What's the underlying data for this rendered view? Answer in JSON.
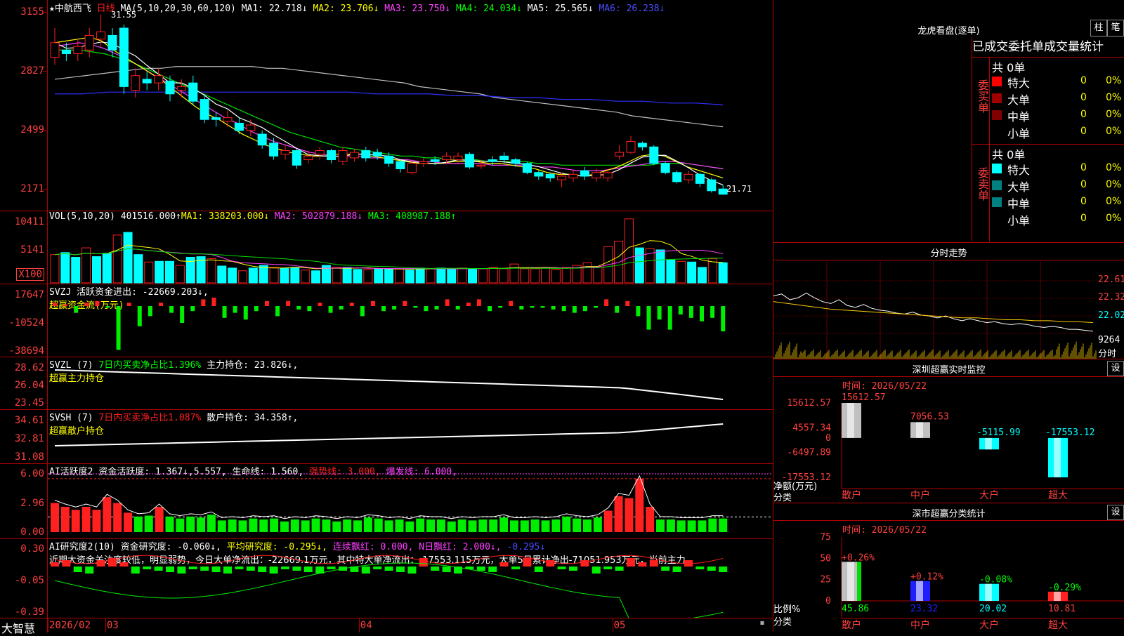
{
  "stock": {
    "name": "中航西飞",
    "period": "日线",
    "ma_header": "MA(5,10,20,30,60,120)",
    "ma": [
      {
        "label": "MA1: 22.718↓",
        "color": "#ffffff"
      },
      {
        "label": "MA2: 23.706↓",
        "color": "#ffff00"
      },
      {
        "label": "MA3: 23.750↓",
        "color": "#ff40ff"
      },
      {
        "label": "MA4: 24.034↓",
        "color": "#00ff00"
      },
      {
        "label": "MA5: 25.565↓",
        "color": "#ffffff"
      },
      {
        "label": "MA6: 26.238↓",
        "color": "#4a4aff"
      }
    ],
    "y_ticks": [
      "3155",
      "2827",
      "2499",
      "2171"
    ],
    "high_label": "31.55",
    "low_label": "21.71"
  },
  "candles": [
    {
      "o": 29.2,
      "c": 30.0,
      "h": 30.8,
      "l": 28.8
    },
    {
      "o": 29.6,
      "c": 29.4,
      "h": 30.0,
      "l": 29.0
    },
    {
      "o": 29.4,
      "c": 29.8,
      "h": 30.2,
      "l": 29.0
    },
    {
      "o": 29.6,
      "c": 30.4,
      "h": 30.8,
      "l": 29.2
    },
    {
      "o": 30.2,
      "c": 30.6,
      "h": 31.55,
      "l": 29.8
    },
    {
      "o": 30.4,
      "c": 29.6,
      "h": 30.8,
      "l": 29.2
    },
    {
      "o": 30.8,
      "c": 27.6,
      "h": 31.0,
      "l": 27.2
    },
    {
      "o": 27.4,
      "c": 28.2,
      "h": 28.6,
      "l": 27.0
    },
    {
      "o": 28.0,
      "c": 27.8,
      "h": 28.4,
      "l": 27.4
    },
    {
      "o": 27.8,
      "c": 28.2,
      "h": 28.6,
      "l": 27.4
    },
    {
      "o": 27.9,
      "c": 27.2,
      "h": 28.2,
      "l": 26.8
    },
    {
      "o": 27.4,
      "c": 27.6,
      "h": 28.0,
      "l": 27.0
    },
    {
      "o": 27.8,
      "c": 26.8,
      "h": 28.2,
      "l": 26.6
    },
    {
      "o": 26.9,
      "c": 25.8,
      "h": 27.2,
      "l": 25.6
    },
    {
      "o": 25.9,
      "c": 25.8,
      "h": 26.2,
      "l": 25.4
    },
    {
      "o": 25.7,
      "c": 25.9,
      "h": 26.3,
      "l": 25.4
    },
    {
      "o": 25.6,
      "c": 25.2,
      "h": 25.9,
      "l": 25.0
    },
    {
      "o": 25.2,
      "c": 25.5,
      "h": 25.8,
      "l": 24.9
    },
    {
      "o": 25.0,
      "c": 24.4,
      "h": 25.2,
      "l": 24.2
    },
    {
      "o": 24.5,
      "c": 23.8,
      "h": 24.8,
      "l": 23.6
    },
    {
      "o": 23.9,
      "c": 24.1,
      "h": 24.4,
      "l": 23.6
    },
    {
      "o": 24.1,
      "c": 23.3,
      "h": 24.2,
      "l": 23.1
    },
    {
      "o": 23.6,
      "c": 23.8,
      "h": 24.1,
      "l": 23.4
    },
    {
      "o": 23.9,
      "c": 24.1,
      "h": 24.3,
      "l": 23.6
    },
    {
      "o": 24.1,
      "c": 23.6,
      "h": 24.2,
      "l": 23.4
    },
    {
      "o": 23.5,
      "c": 24.1,
      "h": 24.3,
      "l": 23.3
    },
    {
      "o": 23.7,
      "c": 24.0,
      "h": 24.2,
      "l": 23.5
    },
    {
      "o": 24.1,
      "c": 23.7,
      "h": 24.3,
      "l": 23.5
    },
    {
      "o": 24.0,
      "c": 23.8,
      "h": 24.2,
      "l": 23.6
    },
    {
      "o": 23.8,
      "c": 23.4,
      "h": 24.0,
      "l": 23.2
    },
    {
      "o": 23.5,
      "c": 23.1,
      "h": 23.6,
      "l": 22.9
    },
    {
      "o": 22.9,
      "c": 23.4,
      "h": 23.6,
      "l": 22.8
    },
    {
      "o": 23.4,
      "c": 23.5,
      "h": 23.7,
      "l": 23.2
    },
    {
      "o": 23.6,
      "c": 23.5,
      "h": 23.8,
      "l": 23.3
    },
    {
      "o": 23.6,
      "c": 23.8,
      "h": 24.0,
      "l": 23.4
    },
    {
      "o": 23.6,
      "c": 23.8,
      "h": 24.0,
      "l": 23.4
    },
    {
      "o": 23.9,
      "c": 23.2,
      "h": 24.0,
      "l": 23.1
    },
    {
      "o": 23.3,
      "c": 23.3,
      "h": 23.6,
      "l": 23.1
    },
    {
      "o": 23.6,
      "c": 23.5,
      "h": 23.8,
      "l": 23.3
    },
    {
      "o": 23.8,
      "c": 23.6,
      "h": 24.0,
      "l": 23.4
    },
    {
      "o": 23.6,
      "c": 23.4,
      "h": 23.7,
      "l": 23.2
    },
    {
      "o": 23.4,
      "c": 22.9,
      "h": 23.5,
      "l": 22.8
    },
    {
      "o": 22.9,
      "c": 22.7,
      "h": 23.0,
      "l": 22.5
    },
    {
      "o": 22.8,
      "c": 22.6,
      "h": 22.9,
      "l": 22.4
    },
    {
      "o": 22.5,
      "c": 22.7,
      "h": 22.9,
      "l": 22.1
    },
    {
      "o": 22.6,
      "c": 22.8,
      "h": 23.0,
      "l": 22.4
    },
    {
      "o": 23.0,
      "c": 22.7,
      "h": 23.2,
      "l": 22.5
    },
    {
      "o": 22.6,
      "c": 22.9,
      "h": 23.1,
      "l": 22.4
    },
    {
      "o": 22.6,
      "c": 22.9,
      "h": 23.1,
      "l": 22.4
    },
    {
      "o": 23.8,
      "c": 24.0,
      "h": 24.4,
      "l": 23.6
    },
    {
      "o": 24.0,
      "c": 24.6,
      "h": 24.9,
      "l": 23.9
    },
    {
      "o": 24.5,
      "c": 24.3,
      "h": 24.6,
      "l": 24.1
    },
    {
      "o": 24.3,
      "c": 23.4,
      "h": 24.4,
      "l": 23.3
    },
    {
      "o": 23.4,
      "c": 22.9,
      "h": 23.5,
      "l": 22.8
    },
    {
      "o": 22.9,
      "c": 22.4,
      "h": 23.0,
      "l": 22.3
    },
    {
      "o": 22.5,
      "c": 22.8,
      "h": 23.0,
      "l": 22.3
    },
    {
      "o": 22.8,
      "c": 22.3,
      "h": 22.9,
      "l": 22.1
    },
    {
      "o": 22.5,
      "c": 21.9,
      "h": 22.6,
      "l": 21.8
    },
    {
      "o": 22.0,
      "c": 21.71,
      "h": 22.2,
      "l": 21.71
    }
  ],
  "ma_lines": {
    "yellow": [
      30.0,
      30.1,
      30.2,
      30.3,
      30.1,
      29.6,
      29.2,
      28.8,
      28.4,
      28.0,
      27.5,
      27.0,
      26.5,
      26.1,
      25.8,
      25.4,
      25.0,
      24.7,
      24.4,
      24.2,
      24.0,
      23.9,
      23.8,
      23.8,
      23.9,
      23.9,
      23.9,
      23.8,
      23.7,
      23.6,
      23.5,
      23.4,
      23.4,
      23.4,
      23.5,
      23.5,
      23.5,
      23.4,
      23.4,
      23.3,
      23.2,
      23.1,
      22.9,
      22.8,
      22.8,
      22.7,
      22.8,
      23.0,
      23.2,
      23.5,
      23.8,
      23.9,
      23.8,
      23.5,
      23.2,
      23.0,
      22.8,
      22.6
    ],
    "magenta": [
      29.8,
      29.9,
      30.0,
      29.9,
      29.7,
      29.4,
      29.1,
      28.7,
      28.3,
      27.9,
      27.5,
      27.1,
      26.7,
      26.3,
      25.9,
      25.6,
      25.2,
      24.9,
      24.6,
      24.4,
      24.2,
      24.0,
      23.9,
      23.8,
      23.8,
      23.8,
      23.7,
      23.7,
      23.6,
      23.6,
      23.5,
      23.5,
      23.4,
      23.4,
      23.4,
      23.4,
      23.3,
      23.3,
      23.3,
      23.3,
      23.2,
      23.2,
      23.1,
      23.0,
      23.0,
      23.0,
      23.1,
      23.2,
      23.3,
      23.4,
      23.5,
      23.5,
      23.4,
      23.3,
      23.2,
      23.1
    ],
    "green": [
      29.6,
      29.6,
      29.6,
      29.5,
      29.4,
      29.2,
      29.0,
      28.7,
      28.4,
      28.1,
      27.8,
      27.5,
      27.2,
      26.9,
      26.6,
      26.3,
      26.0,
      25.7,
      25.4,
      25.1,
      24.9,
      24.7,
      24.5,
      24.3,
      24.2,
      24.1,
      24.0,
      23.9,
      23.8,
      23.8,
      23.7,
      23.7,
      23.6,
      23.6,
      23.6,
      23.5,
      23.5,
      23.5,
      23.5,
      23.4,
      23.4,
      23.3,
      23.3,
      23.3,
      23.3,
      23.3,
      23.3,
      23.3,
      23.3,
      23.4,
      23.4,
      23.4,
      23.3,
      23.2,
      23.1
    ],
    "gray": [
      28.0,
      28.1,
      28.2,
      28.3,
      28.4,
      28.5,
      28.6,
      28.6,
      28.7,
      28.7,
      28.7,
      28.7,
      28.7,
      28.7,
      28.6,
      28.6,
      28.5,
      28.4,
      28.3,
      28.2,
      28.1,
      28.0,
      27.9,
      27.8,
      27.6,
      27.5,
      27.4,
      27.3,
      27.2,
      27.0,
      26.9,
      26.8,
      26.7,
      26.6,
      26.5,
      26.4,
      26.3,
      26.2,
      26.0,
      25.9,
      25.8,
      25.7,
      25.6,
      25.5,
      25.4
    ],
    "blue": [
      27.2,
      27.2,
      27.3,
      27.3,
      27.3,
      27.3,
      27.3,
      27.3,
      27.3,
      27.3,
      27.3,
      27.3,
      27.2,
      27.2,
      27.2,
      27.1,
      27.1,
      27.0,
      27.0,
      26.9,
      26.9,
      26.8,
      26.8,
      26.7,
      26.7,
      26.6
    ]
  },
  "vol": {
    "label": "VOL(5,10,20)",
    "value": "401516.000↑",
    "ma1": "MA1: 338203.000↓",
    "ma2": "MA2: 502879.188↓",
    "ma3": "MA3: 408987.188↑",
    "y_ticks": [
      "10411",
      "5141"
    ],
    "unit": "X100",
    "bars": [
      4.2,
      4.5,
      3.8,
      5.2,
      3.9,
      4.4,
      7.1,
      7.5,
      4.2,
      3.1,
      3.2,
      3.2,
      2.6,
      3.8,
      3.9,
      3.6,
      2.5,
      2.2,
      1.8,
      2.2,
      2.6,
      2.3,
      2.2,
      2.3,
      1.9,
      1.8,
      2.6,
      2.3,
      2.3,
      2.0,
      2.0,
      2.1,
      2.1,
      2.1,
      1.9,
      2.2,
      2.1,
      2.2,
      2.1,
      2.2,
      2.1,
      2.1,
      2.3,
      2.1,
      2.8,
      2.1,
      2.1,
      2.3,
      2.0,
      2.3,
      2.6,
      3.0,
      2.3,
      5.4,
      6.2,
      9.5,
      5.2,
      5.1,
      4.9,
      3.4,
      3.2,
      3.1,
      2.3,
      3.6,
      3.0
    ]
  },
  "svzj": {
    "label": "SVZJ",
    "value": "活跃资金进出: -22669.203↓,",
    "sub": "超赢资金流(万元)",
    "y_ticks": [
      "17647",
      "-10524",
      "-38694"
    ],
    "bars": [
      0.2,
      0.1,
      -0.4,
      0.2,
      0.3,
      -0.1,
      -2.6,
      0.2,
      -1.2,
      -0.6,
      0.2,
      -0.4,
      -1.0,
      -0.3,
      0.4,
      0.5,
      -0.7,
      -0.4,
      -0.8,
      -0.3,
      0.3,
      -0.6,
      0.3,
      -0.2,
      -0.3,
      0.2,
      -0.4,
      -0.2,
      0.2,
      -0.6,
      0.3,
      -0.3,
      -0.2,
      0.3,
      -0.1,
      -0.3,
      -0.2,
      0.4,
      -0.2,
      0.2,
      0.4,
      -0.3,
      -0.1,
      0.3,
      -0.2,
      -0.1,
      -0.1,
      -0.2,
      -0.3,
      -0.4,
      -0.3,
      -0.1,
      0.4,
      -0.4,
      0.3,
      -0.6,
      -1.4,
      -0.8,
      -1.4,
      -0.5,
      -0.7,
      -0.9,
      -0.7,
      -1.5
    ]
  },
  "svzl": {
    "label": "SVZL (7)",
    "ratio": "7日内买卖净占比1.396%",
    "value": "主力持仓: 23.826↓,",
    "sub": "超赢主力持仓",
    "y_ticks": [
      "28.62",
      "26.04",
      "23.45"
    ]
  },
  "svsh": {
    "label": "SVSH (7)",
    "ratio": "7日内买卖净占比1.087%",
    "value": "散户持仓: 34.358↑,",
    "sub": "超赢散户持仓",
    "y_ticks": [
      "34.61",
      "32.81",
      "31.08"
    ]
  },
  "ai_active": {
    "label": "AI活跃度2",
    "fund": "资金活跃度: 1.367↓,5.557,",
    "life": "生命线: 1.560,",
    "strong": "强势线: 3.000,",
    "burst": "爆发线: 6.000,",
    "y_ticks": [
      "6.00",
      "2.96",
      "0.00"
    ],
    "bars": [
      3.0,
      2.6,
      2.3,
      2.6,
      2.3,
      3.6,
      3.0,
      2.0,
      1.6,
      1.7,
      2.6,
      1.6,
      1.4,
      1.6,
      1.5,
      1.8,
      1.2,
      1.3,
      1.2,
      1.4,
      1.3,
      1.4,
      1.1,
      1.3,
      1.2,
      1.4,
      1.3,
      1.1,
      1.3,
      1.2,
      1.5,
      1.4,
      1.2,
      1.3,
      1.1,
      1.4,
      1.3,
      1.3,
      1.1,
      1.3,
      1.2,
      1.3,
      1.3,
      1.5,
      1.2,
      1.2,
      1.3,
      1.2,
      1.3,
      1.6,
      1.4,
      1.3,
      1.5,
      2.2,
      3.7,
      3.5,
      5.5,
      2.6,
      1.3,
      1.3,
      1.2,
      1.2,
      1.2,
      1.4,
      1.4
    ]
  },
  "ai_research": {
    "label": "AI研究度2(10)",
    "fund": "资金研究度: -0.060↓,",
    "avg": "平均研究度: -0.295↓,",
    "red": "连续飘红: 0.000,",
    "nred": "N日飘红: 2.000↓,",
    "last": "-0.295↓",
    "text": "近期大资金关注度较低，明显弱势，今日大单净流出：-22669.1万元，其中特大单净流出：-17553.115万元，大单5日累计净出-71051.953万元，当前主力",
    "y_ticks": [
      "0.30",
      "-0.05",
      "-0.39"
    ]
  },
  "xaxis": {
    "brand": "大智慧",
    "labels": [
      {
        "text": "2026/02",
        "idx": 0
      },
      {
        "text": "03",
        "idx": 5
      },
      {
        "text": "04",
        "idx": 27
      },
      {
        "text": "05",
        "idx": 49
      }
    ]
  },
  "dragon_tiger": {
    "title": "龙虎看盘(逐单)",
    "btn1": "柱",
    "btn2": "笔",
    "stat_title": "已成交委托单成交量统计",
    "buy_label": "委买单",
    "sell_label": "委卖单",
    "buy_total": "共 0单",
    "sell_total": "共 0单",
    "buy_rows": [
      {
        "label": "特大",
        "count": "0",
        "pct": "0%",
        "color": "#ff0000"
      },
      {
        "label": "大单",
        "count": "0",
        "pct": "0%",
        "color": "#a00000"
      },
      {
        "label": "中单",
        "count": "0",
        "pct": "0%",
        "color": "#800000"
      },
      {
        "label": "小单",
        "count": "0",
        "pct": "0%",
        "color": ""
      }
    ],
    "sell_rows": [
      {
        "label": "特大",
        "count": "0",
        "pct": "0%",
        "color": "#00ffff"
      },
      {
        "label": "大单",
        "count": "0",
        "pct": "0%",
        "color": "#008080"
      },
      {
        "label": "中单",
        "count": "0",
        "pct": "0%",
        "color": "#008080"
      },
      {
        "label": "小单",
        "count": "0",
        "pct": "0%",
        "color": ""
      }
    ]
  },
  "intraday": {
    "title": "分时走势",
    "y_ticks": [
      "22.61",
      "22.32",
      "22.02"
    ],
    "vol_label": "9264",
    "vol_unit": "分时",
    "price": [
      22.28,
      22.3,
      22.24,
      22.26,
      22.31,
      22.26,
      22.22,
      22.2,
      22.24,
      22.18,
      22.16,
      22.19,
      22.15,
      22.13,
      22.12,
      22.1,
      22.09,
      22.11,
      22.08,
      22.07,
      22.05,
      22.07,
      22.04,
      22.02,
      22.04,
      22.02,
      22.0,
      22.01,
      21.99,
      21.98,
      21.99,
      21.98,
      21.96,
      21.95,
      21.96,
      21.95,
      21.93,
      21.93,
      21.92,
      21.91
    ],
    "avg": [
      22.22,
      22.2,
      22.18,
      22.16,
      22.14,
      22.13,
      22.12,
      22.11,
      22.1,
      22.09,
      22.08,
      22.07,
      22.06,
      22.05,
      22.05,
      22.04,
      22.03,
      22.03,
      22.02,
      22.02,
      22.01,
      22.01,
      22.0
    ]
  },
  "sz_monitor": {
    "title": "深圳超赢实时监控",
    "btn": "设",
    "time": "时间: 2026/05/22",
    "y_ticks": [
      "15612.57",
      "4557.34",
      "0",
      "-6497.89",
      "-17553.12"
    ],
    "net_label": "净额(万元)",
    "cat_label": "分类",
    "chart_data": {
      "type": "bar",
      "categories": [
        "散户",
        "中户",
        "大户",
        "超大"
      ],
      "values": [
        15612.57,
        7056.53,
        -5115.99,
        -17553.12
      ],
      "value_labels": [
        "15612.57",
        "7056.53",
        "-5115.99",
        "-17553.12"
      ],
      "ylim": [
        -17553.12,
        15612.57
      ]
    }
  },
  "sz_class": {
    "title": "深市超赢分类统计",
    "btn": "设",
    "time": "时间: 2026/05/22",
    "y_ticks": [
      "75",
      "50",
      "25",
      "0"
    ],
    "ratio_label": "比例%",
    "cat_label": "分类",
    "chart_data": {
      "type": "bar",
      "categories": [
        "散户",
        "中户",
        "大户",
        "超大"
      ],
      "values": [
        45.86,
        23.32,
        20.02,
        10.81
      ],
      "changes": [
        "+0.26%",
        "+0.12%",
        "-0.08%",
        "-0.29%"
      ],
      "value_labels": [
        "45.86",
        "23.32",
        "20.02",
        "10.81"
      ],
      "colors": [
        "#c0c0c0",
        "#2020ff",
        "#00ffff",
        "#ff2020"
      ],
      "ylim": [
        0,
        75
      ]
    }
  }
}
